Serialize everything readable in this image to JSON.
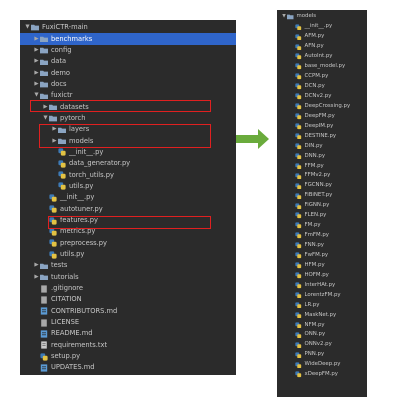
{
  "left_tree": [
    {
      "label": "FuxiCTR-main",
      "depth": 0,
      "type": "folder",
      "expanded": true,
      "selected": false
    },
    {
      "label": "benchmarks",
      "depth": 1,
      "type": "folder",
      "expanded": false,
      "selected": true
    },
    {
      "label": "config",
      "depth": 1,
      "type": "folder",
      "expanded": false
    },
    {
      "label": "data",
      "depth": 1,
      "type": "folder",
      "expanded": false
    },
    {
      "label": "demo",
      "depth": 1,
      "type": "folder",
      "expanded": false
    },
    {
      "label": "docs",
      "depth": 1,
      "type": "folder",
      "expanded": false
    },
    {
      "label": "fuxictr",
      "depth": 1,
      "type": "folder",
      "expanded": true
    },
    {
      "label": "datasets",
      "depth": 2,
      "type": "folder",
      "expanded": false
    },
    {
      "label": "pytorch",
      "depth": 2,
      "type": "folder",
      "expanded": true
    },
    {
      "label": "layers",
      "depth": 3,
      "type": "folder",
      "expanded": false
    },
    {
      "label": "models",
      "depth": 3,
      "type": "folder",
      "expanded": false
    },
    {
      "label": "__init__.py",
      "depth": 3,
      "type": "py"
    },
    {
      "label": "data_generator.py",
      "depth": 3,
      "type": "py"
    },
    {
      "label": "torch_utils.py",
      "depth": 3,
      "type": "py"
    },
    {
      "label": "utils.py",
      "depth": 3,
      "type": "py"
    },
    {
      "label": "__init__.py",
      "depth": 2,
      "type": "py"
    },
    {
      "label": "autotuner.py",
      "depth": 2,
      "type": "py"
    },
    {
      "label": "features.py",
      "depth": 2,
      "type": "py"
    },
    {
      "label": "metrics.py",
      "depth": 2,
      "type": "py"
    },
    {
      "label": "preprocess.py",
      "depth": 2,
      "type": "py"
    },
    {
      "label": "utils.py",
      "depth": 2,
      "type": "py"
    },
    {
      "label": "tests",
      "depth": 1,
      "type": "folder",
      "expanded": false
    },
    {
      "label": "tutorials",
      "depth": 1,
      "type": "folder",
      "expanded": false
    },
    {
      "label": ".gitignore",
      "depth": 1,
      "type": "file"
    },
    {
      "label": "CITATION",
      "depth": 1,
      "type": "file"
    },
    {
      "label": "CONTRIBUTORS.md",
      "depth": 1,
      "type": "md"
    },
    {
      "label": "LICENSE",
      "depth": 1,
      "type": "file"
    },
    {
      "label": "README.md",
      "depth": 1,
      "type": "md"
    },
    {
      "label": "requirements.txt",
      "depth": 1,
      "type": "txt"
    },
    {
      "label": "setup.py",
      "depth": 1,
      "type": "py"
    },
    {
      "label": "UPDATES.md",
      "depth": 1,
      "type": "md"
    }
  ],
  "right_tree": [
    {
      "label": "models",
      "depth": 0,
      "type": "folder",
      "expanded": true
    },
    {
      "label": "__init__.py",
      "depth": 1,
      "type": "py"
    },
    {
      "label": "AFM.py",
      "depth": 1,
      "type": "py"
    },
    {
      "label": "AFN.py",
      "depth": 1,
      "type": "py"
    },
    {
      "label": "AutoInt.py",
      "depth": 1,
      "type": "py"
    },
    {
      "label": "base_model.py",
      "depth": 1,
      "type": "py"
    },
    {
      "label": "CCPM.py",
      "depth": 1,
      "type": "py"
    },
    {
      "label": "DCN.py",
      "depth": 1,
      "type": "py"
    },
    {
      "label": "DCNv2.py",
      "depth": 1,
      "type": "py"
    },
    {
      "label": "DeepCrossing.py",
      "depth": 1,
      "type": "py"
    },
    {
      "label": "DeepFM.py",
      "depth": 1,
      "type": "py"
    },
    {
      "label": "DeepIM.py",
      "depth": 1,
      "type": "py"
    },
    {
      "label": "DESTINE.py",
      "depth": 1,
      "type": "py"
    },
    {
      "label": "DIN.py",
      "depth": 1,
      "type": "py"
    },
    {
      "label": "DNN.py",
      "depth": 1,
      "type": "py"
    },
    {
      "label": "FFM.py",
      "depth": 1,
      "type": "py"
    },
    {
      "label": "FFMv2.py",
      "depth": 1,
      "type": "py"
    },
    {
      "label": "FGCNN.py",
      "depth": 1,
      "type": "py"
    },
    {
      "label": "FiBiNET.py",
      "depth": 1,
      "type": "py"
    },
    {
      "label": "FiGNN.py",
      "depth": 1,
      "type": "py"
    },
    {
      "label": "FLEN.py",
      "depth": 1,
      "type": "py"
    },
    {
      "label": "FM.py",
      "depth": 1,
      "type": "py"
    },
    {
      "label": "FmFM.py",
      "depth": 1,
      "type": "py"
    },
    {
      "label": "FNN.py",
      "depth": 1,
      "type": "py"
    },
    {
      "label": "FwFM.py",
      "depth": 1,
      "type": "py"
    },
    {
      "label": "HFM.py",
      "depth": 1,
      "type": "py"
    },
    {
      "label": "HOFM.py",
      "depth": 1,
      "type": "py"
    },
    {
      "label": "InterHAt.py",
      "depth": 1,
      "type": "py"
    },
    {
      "label": "LorentzFM.py",
      "depth": 1,
      "type": "py"
    },
    {
      "label": "LR.py",
      "depth": 1,
      "type": "py"
    },
    {
      "label": "MaskNet.py",
      "depth": 1,
      "type": "py"
    },
    {
      "label": "NFM.py",
      "depth": 1,
      "type": "py"
    },
    {
      "label": "ONN.py",
      "depth": 1,
      "type": "py"
    },
    {
      "label": "ONNv2.py",
      "depth": 1,
      "type": "py"
    },
    {
      "label": "PNN.py",
      "depth": 1,
      "type": "py"
    },
    {
      "label": "WideDeep.py",
      "depth": 1,
      "type": "py"
    },
    {
      "label": "xDeepFM.py",
      "depth": 1,
      "type": "py"
    }
  ],
  "icons": {
    "folder": "folder-icon",
    "py": "python-file-icon",
    "md": "markdown-file-icon",
    "txt": "text-file-icon",
    "file": "generic-file-icon",
    "expanded": "chevron-down-icon",
    "collapsed": "chevron-right-icon",
    "arrow": "green-right-arrow"
  },
  "colors": {
    "panel_bg": "#2b2b2b",
    "text": "#c8c8c8",
    "selected_bg": "#2f65ca",
    "folder": "#8aa4c2",
    "py_blue": "#3d7ab6",
    "py_yellow": "#e3c243",
    "highlight_border": "#e02020",
    "arrow": "#6aab3c"
  }
}
